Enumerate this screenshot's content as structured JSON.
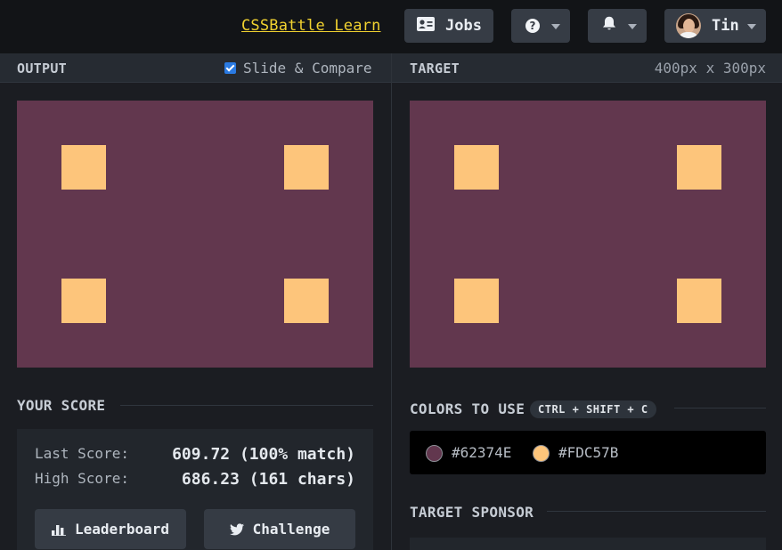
{
  "topbar": {
    "learn_link": "CSSBattle Learn",
    "jobs_label": "Jobs",
    "help_glyph": "?",
    "user_name": "Tin",
    "icons": [
      "id-card-icon",
      "help-circle-icon",
      "bell-icon",
      "avatar"
    ]
  },
  "output_panel": {
    "title": "OUTPUT",
    "compare_label": "Slide & Compare",
    "compare_checked": true
  },
  "target_panel": {
    "title": "TARGET",
    "dimensions": "400px x 300px"
  },
  "canvas": {
    "background": "#62374E",
    "square_color": "#FDC57B"
  },
  "score": {
    "title": "YOUR SCORE",
    "last_label": "Last Score:",
    "last_value": "609.72 (100% match)",
    "high_label": "High Score:",
    "high_value": "686.23 (161 chars)",
    "leaderboard_label": "Leaderboard",
    "challenge_label": "Challenge"
  },
  "colors": {
    "title": "COLORS TO USE",
    "shortcut": "CTRL + SHIFT + C",
    "items": [
      {
        "hex": "#62374E"
      },
      {
        "hex": "#FDC57B"
      }
    ]
  },
  "sponsor": {
    "title": "TARGET SPONSOR"
  }
}
